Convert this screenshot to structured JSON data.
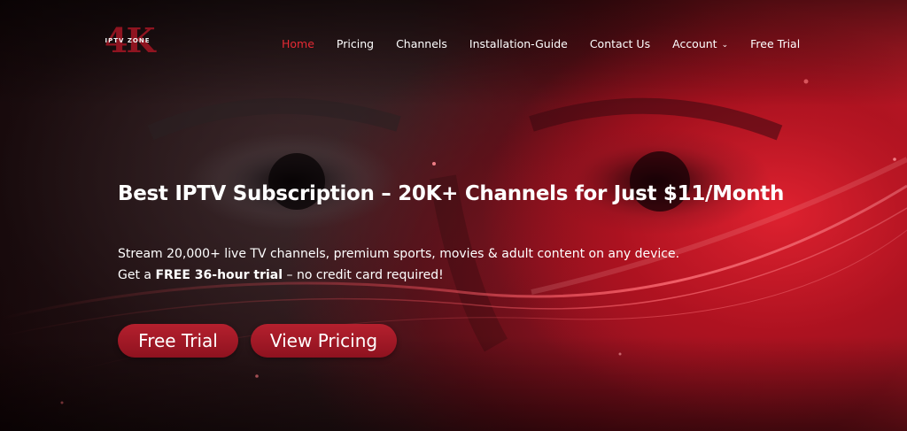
{
  "brand": {
    "logo_mark": "4K",
    "logo_text": "IPTV ZONE"
  },
  "nav": {
    "items": [
      {
        "label": "Home",
        "active": true
      },
      {
        "label": "Pricing"
      },
      {
        "label": "Channels"
      },
      {
        "label": "Installation-Guide"
      },
      {
        "label": "Contact Us"
      },
      {
        "label": "Account",
        "has_dropdown": true
      },
      {
        "label": "Free Trial"
      }
    ],
    "dropdown_icon": "chevron-down-icon"
  },
  "hero": {
    "headline": "Best IPTV Subscription – 20K+ Channels for Just $11/Month",
    "line1": "Stream 20,000+ live TV channels, premium sports, movies & adult content on any device.",
    "line2_prefix": "Get a ",
    "line2_bold": "FREE 36-hour trial",
    "line2_suffix": " – no credit card required!",
    "buttons": {
      "primary": "Free Trial",
      "secondary": "View Pricing"
    }
  },
  "colors": {
    "accent": "#e52a34",
    "button": "#a11927",
    "background_dark": "#1a0608",
    "background_red": "#c91f2c"
  }
}
